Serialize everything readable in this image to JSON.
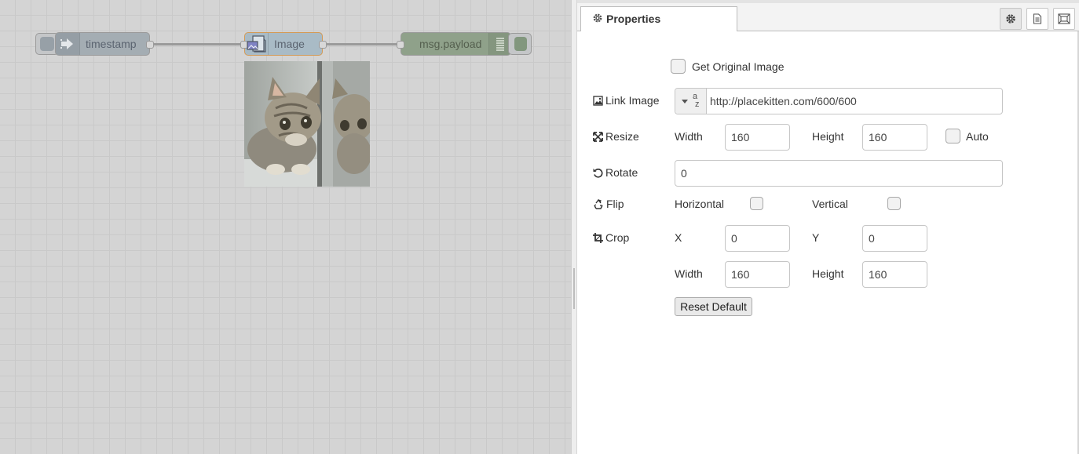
{
  "flow": {
    "inject_label": "timestamp",
    "image_label": "Image",
    "debug_label": "msg.payload"
  },
  "panel": {
    "tab_label": "Properties",
    "get_original_label": "Get Original Image",
    "link_image": {
      "label": "Link Image",
      "value": "http://placekitten.com/600/600",
      "type_hint": "a z"
    },
    "resize": {
      "label": "Resize",
      "width_label": "Width",
      "width_value": "160",
      "height_label": "Height",
      "height_value": "160",
      "auto_label": "Auto"
    },
    "rotate": {
      "label": "Rotate",
      "value": "0"
    },
    "flip": {
      "label": "Flip",
      "horizontal_label": "Horizontal",
      "vertical_label": "Vertical"
    },
    "crop": {
      "label": "Crop",
      "x_label": "X",
      "x_value": "0",
      "y_label": "Y",
      "y_value": "0",
      "width_label": "Width",
      "width_value": "160",
      "height_label": "Height",
      "height_value": "160"
    },
    "reset_label": "Reset Default"
  },
  "icons": {
    "tab": "gear-icon",
    "buttons": [
      "settings-icon",
      "document-icon",
      "frame-icon"
    ]
  }
}
